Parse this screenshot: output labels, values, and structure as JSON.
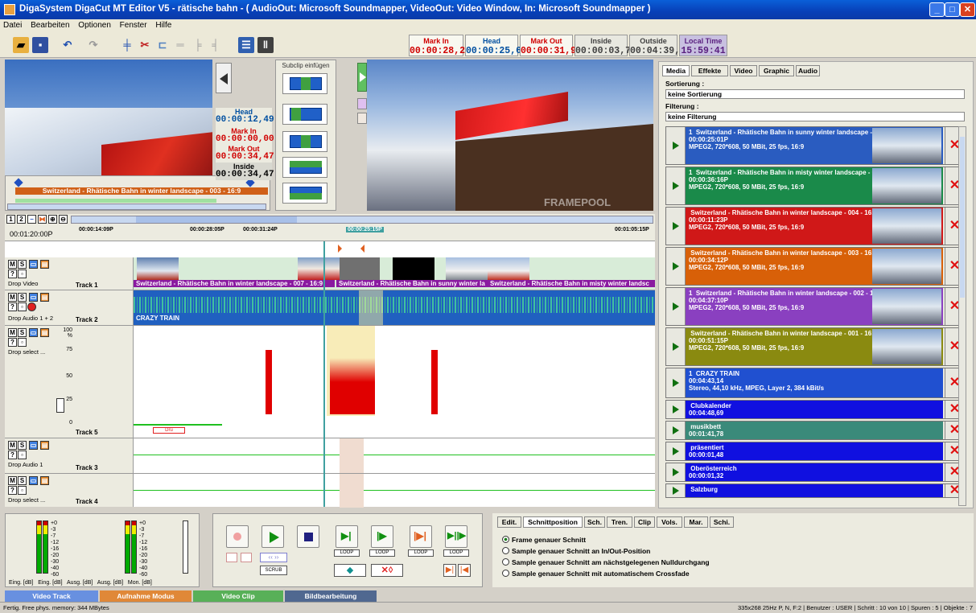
{
  "window": {
    "title": "DigaSystem DigaCut MT Editor V5 - rätische bahn - ( AudioOut: Microsoft Soundmapper, VideoOut: Video Window, In: Microsoft Soundmapper )"
  },
  "menu": [
    "Datei",
    "Bearbeiten",
    "Optionen",
    "Fenster",
    "Hilfe"
  ],
  "timecodes": [
    {
      "label": "Mark In",
      "value": "00:00:28,20",
      "color": "#d00000"
    },
    {
      "label": "Head",
      "value": "00:00:25,63",
      "color": "#004fa0"
    },
    {
      "label": "Mark Out",
      "value": "00:00:31,99",
      "color": "#d00000"
    },
    {
      "label": "Inside",
      "value": "00:00:03,79",
      "color": "#404040"
    },
    {
      "label": "Outside",
      "value": "00:04:39,34",
      "color": "#404040"
    },
    {
      "label": "Local Time",
      "value": "15:59:41",
      "color": "#5a2080"
    }
  ],
  "left_monitor": {
    "head_label": "Head",
    "head_value": "00:00:12,49",
    "markin_label": "Mark In",
    "markin_value": "00:00:00,00",
    "markout_label": "Mark Out",
    "markout_value": "00:00:34,47",
    "inside_label": "Inside",
    "inside_value": "00:00:34,47",
    "clip_label": "Switzerland - Rhätische Bahn in winter landscape - 003 - 16:9"
  },
  "subclip": {
    "title": "Subclip einfügen"
  },
  "right_monitor": {
    "watermark": "FRAMEPOOL"
  },
  "timeline": {
    "position": "00:01:20:00P",
    "ruler": [
      "00:00:14:09P",
      "00:00:28:05P",
      "00:00:31:24P",
      "00:00:25:15P",
      "00:01:05:15P"
    ],
    "tracks": [
      {
        "name": "Track 1",
        "drop": "Drop Video",
        "clips": [
          "Switzerland - Rhätische Bahn in winter landscape - 007 - 16:9",
          "Switzerland - Rhätische Bahn in sunny winter la",
          "Switzerland - Rhätische Bahn in misty winter landsc"
        ]
      },
      {
        "name": "Track 2",
        "drop": "Drop Audio 1 + 2",
        "clips": [
          "CRAZY TRAIN"
        ]
      },
      {
        "name": "Track 5",
        "drop": "Drop select ...",
        "scale": [
          "100",
          "%",
          "75",
          "50",
          "25",
          "0"
        ]
      },
      {
        "name": "Track 3",
        "drop": "Drop Audio 1"
      },
      {
        "name": "Track 4",
        "drop": "Drop select ..."
      }
    ]
  },
  "media_panel": {
    "tabs": [
      "Media",
      "Effekte",
      "Video",
      "Graphic",
      "Audio"
    ],
    "sort_label": "Sortierung :",
    "sort_value": "keine Sortierung",
    "filter_label": "Filterung :",
    "filter_value": "keine Filterung",
    "items": [
      {
        "num": "1",
        "title": "Switzerland - Rhätische Bahn in sunny winter landscape - 006 - 16:9",
        "dur": "00:00:25:01P",
        "info": "MPEG2, 720*608, 50 MBit, 25 fps, 16:9",
        "color": "#2a5cc0"
      },
      {
        "num": "1",
        "title": "Switzerland - Rhätische Bahn in misty winter landscape - 005 - 16:9",
        "dur": "00:00:36:16P",
        "info": "MPEG2, 720*608, 50 MBit, 25 fps, 16:9",
        "color": "#1a8a4a"
      },
      {
        "num": "",
        "title": "Switzerland - Rhätische Bahn in winter landscape - 004 - 16:9",
        "dur": "00:00:11:23P",
        "info": "MPEG2, 720*608, 50 MBit, 25 fps, 16:9",
        "color": "#d01818"
      },
      {
        "num": "",
        "title": "Switzerland - Rhätische Bahn in winter landscape - 003 - 16:9",
        "dur": "00:00:34:12P",
        "info": "MPEG2, 720*608, 50 MBit, 25 fps, 16:9",
        "color": "#d86008"
      },
      {
        "num": "1",
        "title": "Switzerland - Rhätische Bahn in winter landscape - 002 - 16:9",
        "dur": "00:04:37:10P",
        "info": "MPEG2, 720*608, 50 MBit, 25 fps, 16:9",
        "color": "#8a40c0"
      },
      {
        "num": "",
        "title": "Switzerland - Rhätische Bahn in winter landscape - 001 - 16:9",
        "dur": "00:00:51:15P",
        "info": "MPEG2, 720*608, 50 MBit, 25 fps, 16:9",
        "color": "#8a8a10"
      },
      {
        "num": "1",
        "title": "CRAZY TRAIN",
        "dur": "00:04:43,14",
        "info": "Stereo, 44,10 kHz, MPEG, Layer 2, 384 kBit/s",
        "color": "#2050d0"
      },
      {
        "num": "",
        "title": "Clubkalender",
        "dur": "00:04:48,69",
        "info": "",
        "color": "#1010e0"
      },
      {
        "num": "",
        "title": "musikbett",
        "dur": "00:01:41,78",
        "info": "",
        "color": "#3a8a7a"
      },
      {
        "num": "",
        "title": "präsentiert",
        "dur": "00:00:01,48",
        "info": "",
        "color": "#1010e0"
      },
      {
        "num": "",
        "title": "Oberösterreich",
        "dur": "00:00:01,32",
        "info": "",
        "color": "#1010e0"
      },
      {
        "num": "",
        "title": "Salzburg",
        "dur": "",
        "info": "",
        "color": "#1010e0"
      }
    ]
  },
  "meters": {
    "scale": [
      "+0",
      "-3",
      "-7",
      "-12",
      "-16",
      "-20",
      "-30",
      "-40",
      "-60"
    ],
    "labels": [
      "Eing. [dB]",
      "Eing. [dB]",
      "Ausg. [dB]",
      "Ausg. [dB]",
      "Mon. [dB]"
    ]
  },
  "transport": {
    "loop": "LOOP",
    "scrub": "SCRUB"
  },
  "cut_panel": {
    "tabs": [
      "Edit.",
      "Schnittposition",
      "Sch.",
      "Tren.",
      "Clip",
      "Vols.",
      "Mar.",
      "Schi."
    ],
    "options": [
      "Frame genauer Schnitt",
      "Sample genauer Schnitt an In/Out-Position",
      "Sample genauer Schnitt am nächstgelegenen Nulldurchgang",
      "Sample genauer Schnitt mit automatischem Crossfade"
    ],
    "selected": 0
  },
  "mode_tabs": [
    {
      "label": "Video Track",
      "color": "#6890e0"
    },
    {
      "label": "Aufnahme Modus",
      "color": "#e08838"
    },
    {
      "label": "Video Clip",
      "color": "#58b058"
    },
    {
      "label": "Bildbearbeitung",
      "color": "#506890"
    }
  ],
  "status": {
    "left": "Fertig. Free phys. memory: 344 MBytes",
    "right": "335x268 25Hz P, N, F:2  |  Benutzer : USER  |  Schritt : 10 von 10  |  Spuren : 5  |  Objekte : 7"
  }
}
